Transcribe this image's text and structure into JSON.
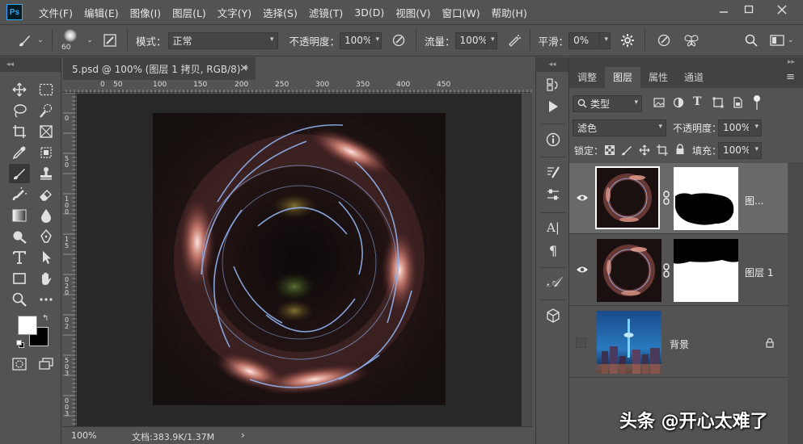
{
  "app": {
    "logo": "Ps",
    "menu": [
      "文件(F)",
      "编辑(E)",
      "图像(I)",
      "图层(L)",
      "文字(Y)",
      "选择(S)",
      "滤镜(T)",
      "3D(D)",
      "视图(V)",
      "窗口(W)",
      "帮助(H)"
    ]
  },
  "options": {
    "brush_size": "60",
    "mode_label": "模式：",
    "mode_value": "正常",
    "opacity_label": "不透明度：",
    "opacity_value": "100%",
    "flow_label": "流量：",
    "flow_value": "100%",
    "smooth_label": "平滑：",
    "smooth_value": "0%"
  },
  "document": {
    "tab_title": "5.psd @ 100% (图层 1 拷贝, RGB/8) *",
    "ruler_h": [
      "0",
      "50",
      "100",
      "150",
      "200",
      "250",
      "300",
      "350",
      "400",
      "450"
    ],
    "ruler_v": [
      "0",
      "5",
      "0",
      "1",
      "0",
      "0",
      "1",
      "5",
      "0",
      "2",
      "0",
      "0",
      "2",
      "5",
      "0",
      "3",
      "0",
      "0",
      "3",
      "5",
      "0"
    ],
    "zoom": "100%",
    "doc_info": "文档:383.9K/1.37M"
  },
  "layers": {
    "tabs": [
      "调整",
      "图层",
      "属性",
      "通道"
    ],
    "active_tab": "图层",
    "filter_label": "类型",
    "blend_mode": "滤色",
    "opacity_label": "不透明度：",
    "opacity_value": "100%",
    "lock_label": "锁定：",
    "fill_label": "填充：",
    "fill_value": "100%",
    "items": [
      {
        "name": "图...",
        "visible": true,
        "selected": true
      },
      {
        "name": "图层 1",
        "visible": true,
        "selected": false
      },
      {
        "name": "背景",
        "visible": false,
        "selected": false,
        "locked": true
      }
    ]
  },
  "watermark": "头条 @开心太难了",
  "colors": {
    "accent": "#31a8ff",
    "panel": "#535353",
    "dark": "#282828"
  }
}
